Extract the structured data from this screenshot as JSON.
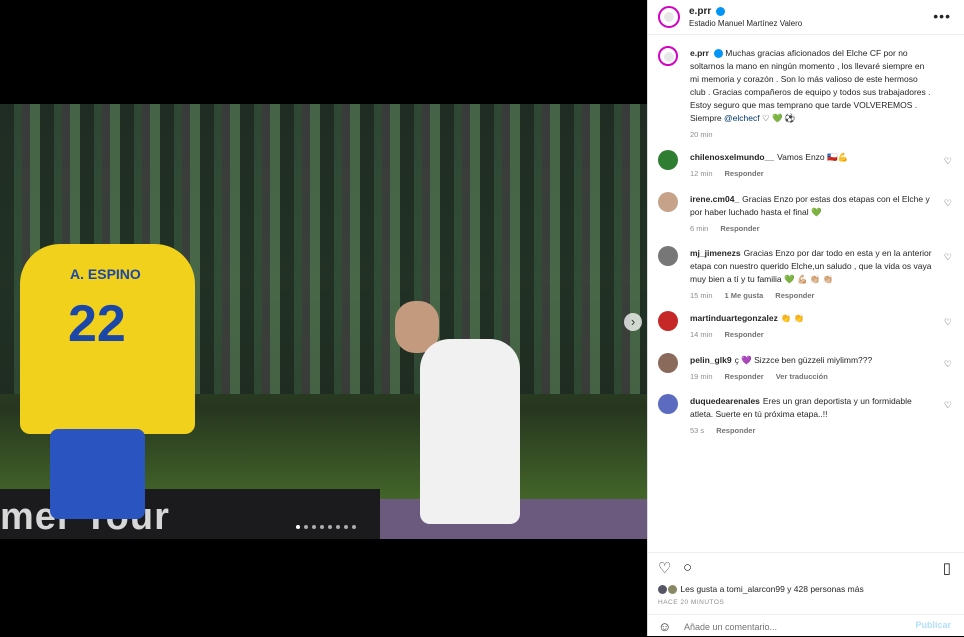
{
  "post": {
    "username": "e.prr",
    "location": "Estadio Manuel Martínez Valero",
    "more_icon": "more-horizontal-icon",
    "caption": {
      "username": "e.prr",
      "text": "Muchas gracias aficionados del Elche CF por no soltarnos la mano en ningún momento , los llevaré siempre en mi memoria y corazón . Son lo más valioso de este hermoso club . Gracias compañeros de equipo y todos sus trabajadores . Estoy seguro que mas temprano que tarde VOLVEREMOS . Siempre",
      "mention": "@elchecf",
      "emojis": "♡ 💚 ⚽",
      "time": "20 min"
    },
    "media": {
      "board_text": "mer Tour",
      "player_name": "A. ESPINO",
      "player_number": "22",
      "next_icon": "chevron-right-icon",
      "slide_count": 8,
      "active_slide": 1
    }
  },
  "comments": [
    {
      "user": "chilenosxelmundo__",
      "text": "Vamos Enzo 🇨🇱💪",
      "time": "12 min",
      "likes": "",
      "reply": "Responder",
      "translate": ""
    },
    {
      "user": "irene.cm04_",
      "text": "Gracias Enzo por estas dos etapas con el Elche y por haber luchado hasta el final 💚",
      "time": "6 min",
      "likes": "",
      "reply": "Responder",
      "translate": ""
    },
    {
      "user": "mj_jimenezs",
      "text": "Gracias Enzo por dar todo en esta y en la anterior etapa con nuestro querido Elche,un saludo , que la vida os vaya muy bien a tí y tu familia 💚 💪🏼 👏🏼 👏🏼",
      "time": "15 min",
      "likes": "1 Me gusta",
      "reply": "Responder",
      "translate": ""
    },
    {
      "user": "martinduartegonzalez",
      "text": "👏 👏",
      "time": "14 min",
      "likes": "",
      "reply": "Responder",
      "translate": ""
    },
    {
      "user": "pelin_glk9",
      "text": "ç 💜 Sizzce ben güzzeli miylimm???",
      "time": "19 min",
      "likes": "",
      "reply": "Responder",
      "translate": "Ver traducción"
    },
    {
      "user": "duquedearenales",
      "text": "Eres un gran deportista y un formidable atleta. Suerte en tú próxima etapa..!!",
      "time": "53 s",
      "likes": "",
      "reply": "Responder",
      "translate": ""
    }
  ],
  "actions": {
    "like_icon": "heart-icon",
    "comment_icon": "comment-icon",
    "save_icon": "bookmark-icon"
  },
  "likes_text": "Les gusta a tomi_alarcon99 y 428 personas más",
  "posted_ago": "HACE 20 MINUTOS",
  "add_comment": {
    "emoji_icon": "emoji-icon",
    "placeholder": "Añade un comentario...",
    "publish": "Publicar"
  },
  "colors": {
    "verified": "#0095f6",
    "link": "#00376b",
    "publish_disabled": "#b2dffc"
  }
}
